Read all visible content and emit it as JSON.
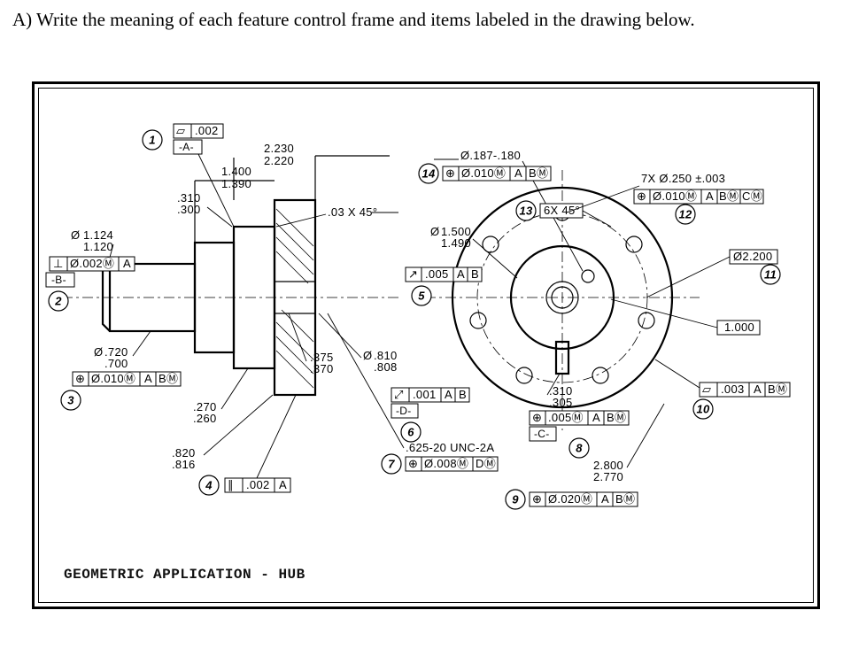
{
  "question_text": "A) Write the meaning of each feature control frame and items labeled in the drawing below.",
  "title_block": "GEOMETRIC APPLICATION - HUB",
  "dims": {
    "d2230_2220_u": "2.230",
    "d2230_2220_l": "2.220",
    "d1400_1390_u": "1.400",
    "d1390_l": "1.390",
    "d310_300_u": ".310",
    "d310_300_l": ".300",
    "d1124_u": "1.124",
    "d1124_l": "1.120",
    "d720_u": ".720",
    "d720_l": ".700",
    "d270_u": ".270",
    "d270_l": ".260",
    "d820_u": ".820",
    "d820_l": ".816",
    "d375_u": ".375",
    "d375_l": ".370",
    "d810_u": ".810",
    "d810_l": ".808",
    "d1500_u": "1.500",
    "d1500_l": "1.490",
    "d310b_u": ".310",
    "d310b_l": ".305",
    "d2800_u": "2.800",
    "d2800_l": "2.770",
    "d187_180": "Ø.187-.180",
    "d2200": "Ø2.200",
    "d1000": "1.000",
    "chamf_shaft": ".03 X 45°",
    "chamf_flange": "6X 45°",
    "holes_note": "7X Ø.250 ±.003",
    "thread": ".625-20 UNC-2A"
  },
  "datum_labels": {
    "A": "-A-",
    "B": "-B-",
    "C": "-C-",
    "D": "-D-"
  },
  "fcf": {
    "flat002": {
      "sym": "▱",
      "tol": ".002"
    },
    "perp002A": {
      "sym": "⊥",
      "tol": "Ø.002Ⓜ",
      "d1": "A"
    },
    "pos010AB_3": {
      "sym": "⊕",
      "tol": "Ø.010Ⓜ",
      "d1": "A",
      "d2": "BⓂ"
    },
    "par002A": {
      "sym": "∥",
      "tol": ".002",
      "d1": "A"
    },
    "run005AB": {
      "sym": "↗",
      "tol": ".005",
      "d1": "A",
      "d2": "B"
    },
    "run001AB": {
      "sym": "⤢",
      "tol": ".001",
      "d1": "A",
      "d2": "B"
    },
    "pos008DM": {
      "sym": "⊕",
      "tol": "Ø.008Ⓜ",
      "d1": "DⓂ"
    },
    "pos005AB": {
      "sym": "⊕",
      "tol": ".005Ⓜ",
      "d1": "A",
      "d2": "BⓂ"
    },
    "pos020AB": {
      "sym": "⊕",
      "tol": "Ø.020Ⓜ",
      "d1": "A",
      "d2": "BⓂ"
    },
    "flat003AB": {
      "sym": "▱",
      "tol": ".003",
      "d1": "A",
      "d2": "BⓂ"
    },
    "pos010AB_14": {
      "sym": "⊕",
      "tol": "Ø.010Ⓜ",
      "d1": "A",
      "d2": "BⓂ"
    },
    "pos010ABC": {
      "sym": "⊕",
      "tol": "Ø.010Ⓜ",
      "d1": "A",
      "d2": "BⓂ",
      "d3": "CⓂ"
    }
  },
  "bubbles": {
    "n1": "1",
    "n2": "2",
    "n3": "3",
    "n4": "4",
    "n5": "5",
    "n6": "6",
    "n7": "7",
    "n8": "8",
    "n9": "9",
    "n10": "10",
    "n11": "11",
    "n12": "12",
    "n13": "13",
    "n14": "14"
  },
  "symbols_legend": {
    "dia": "Ø",
    "mmc": "Ⓜ",
    "pos": "⊕",
    "perp": "⊥",
    "par": "∥",
    "flat": "▱",
    "runout": "↗",
    "total_runout": "⤢"
  }
}
